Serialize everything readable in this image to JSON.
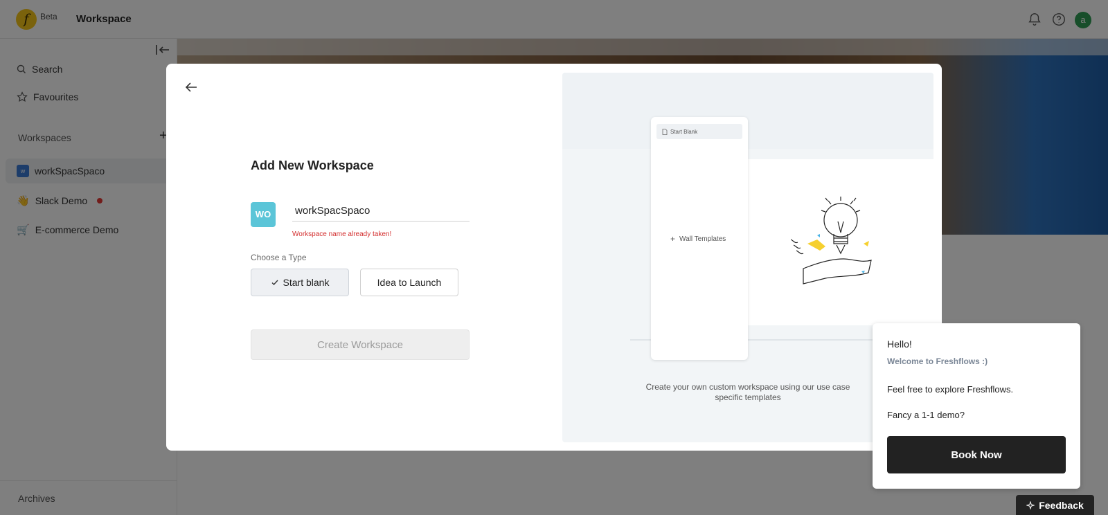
{
  "app": {
    "logo_letter": "f",
    "beta_label": "Beta",
    "title": "Workspace",
    "avatar_letter": "a"
  },
  "sidebar": {
    "search": "Search",
    "favourites": "Favourites",
    "workspaces_heading": "Workspaces",
    "workspaces": [
      {
        "label": "workSpacSpaco",
        "badge": "w"
      },
      {
        "label": "Slack Demo",
        "icon": "waving-hand-icon"
      },
      {
        "label": "E-commerce Demo",
        "icon": "shopping-cart-icon"
      }
    ],
    "archives": "Archives"
  },
  "modal": {
    "title": "Add New Workspace",
    "badge_text": "WO",
    "name_value": "workSpacSpaco",
    "name_error": "Workspace name already taken!",
    "type_label": "Choose a Type",
    "types": [
      {
        "label": "Start blank",
        "selected": true
      },
      {
        "label": "Idea to Launch",
        "selected": false
      }
    ],
    "create_label": "Create Workspace",
    "preview": {
      "start_blank": "Start Blank",
      "wall_templates": "Wall Templates",
      "caption": "Create your own custom workspace using our use case specific templates"
    }
  },
  "chat": {
    "hello": "Hello!",
    "welcome": "Welcome to Freshflows :)",
    "explore": "Feel free to explore Freshflows.",
    "demo": "Fancy a 1-1 demo?",
    "book_label": "Book Now"
  },
  "feedback_label": "Feedback",
  "colors": {
    "accent_badge": "#5bc5d8",
    "error": "#d32f2f",
    "dark_button": "#222222"
  }
}
